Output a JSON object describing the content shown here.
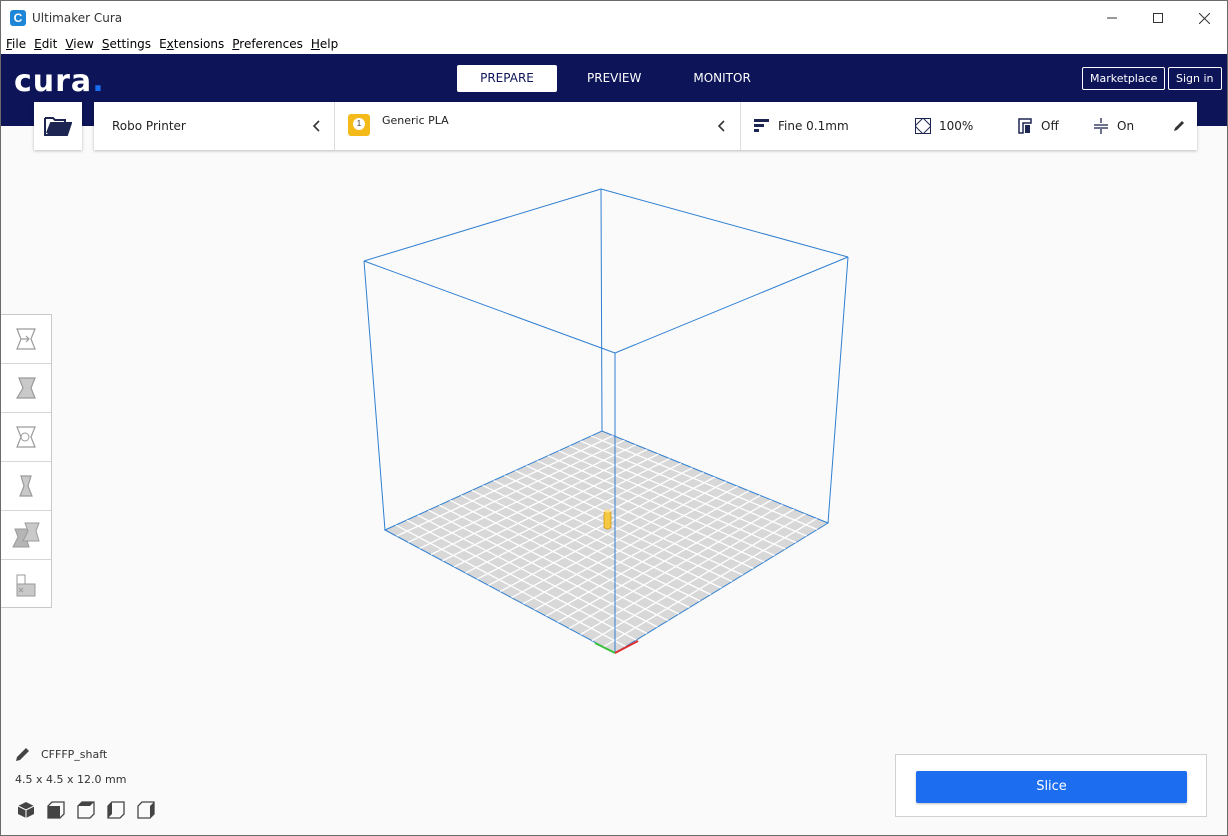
{
  "window": {
    "title": "Ultimaker Cura"
  },
  "menu": [
    {
      "accel": "F",
      "rest": "ile"
    },
    {
      "accel": "E",
      "rest": "dit"
    },
    {
      "accel": "V",
      "rest": "iew"
    },
    {
      "accel": "S",
      "rest": "ettings"
    },
    {
      "accel": "",
      "pre": "E",
      "accel2": "x",
      "rest": "tensions"
    },
    {
      "accel": "P",
      "rest": "references"
    },
    {
      "accel": "H",
      "rest": "elp"
    }
  ],
  "header": {
    "logo": "cura",
    "logo_dot": ".",
    "tabs": [
      "PREPARE",
      "PREVIEW",
      "MONITOR"
    ],
    "marketplace_label": "Marketplace",
    "signin_label": "Sign in"
  },
  "toolbar": {
    "printer": "Robo Printer",
    "material_index": "1",
    "material": "Generic PLA",
    "quality": "Fine 0.1mm",
    "infill": "100%",
    "support": "Off",
    "adhesion": "On"
  },
  "object": {
    "name": "CFFFP_shaft",
    "dimensions": "4.5 x 4.5 x 12.0 mm"
  },
  "slice": {
    "label": "Slice"
  },
  "colors": {
    "header_bg": "#0d1558",
    "accent_blue": "#1c6df0",
    "material_yellow": "#f3ba1a",
    "build_volume_line": "#2f7fd1"
  }
}
